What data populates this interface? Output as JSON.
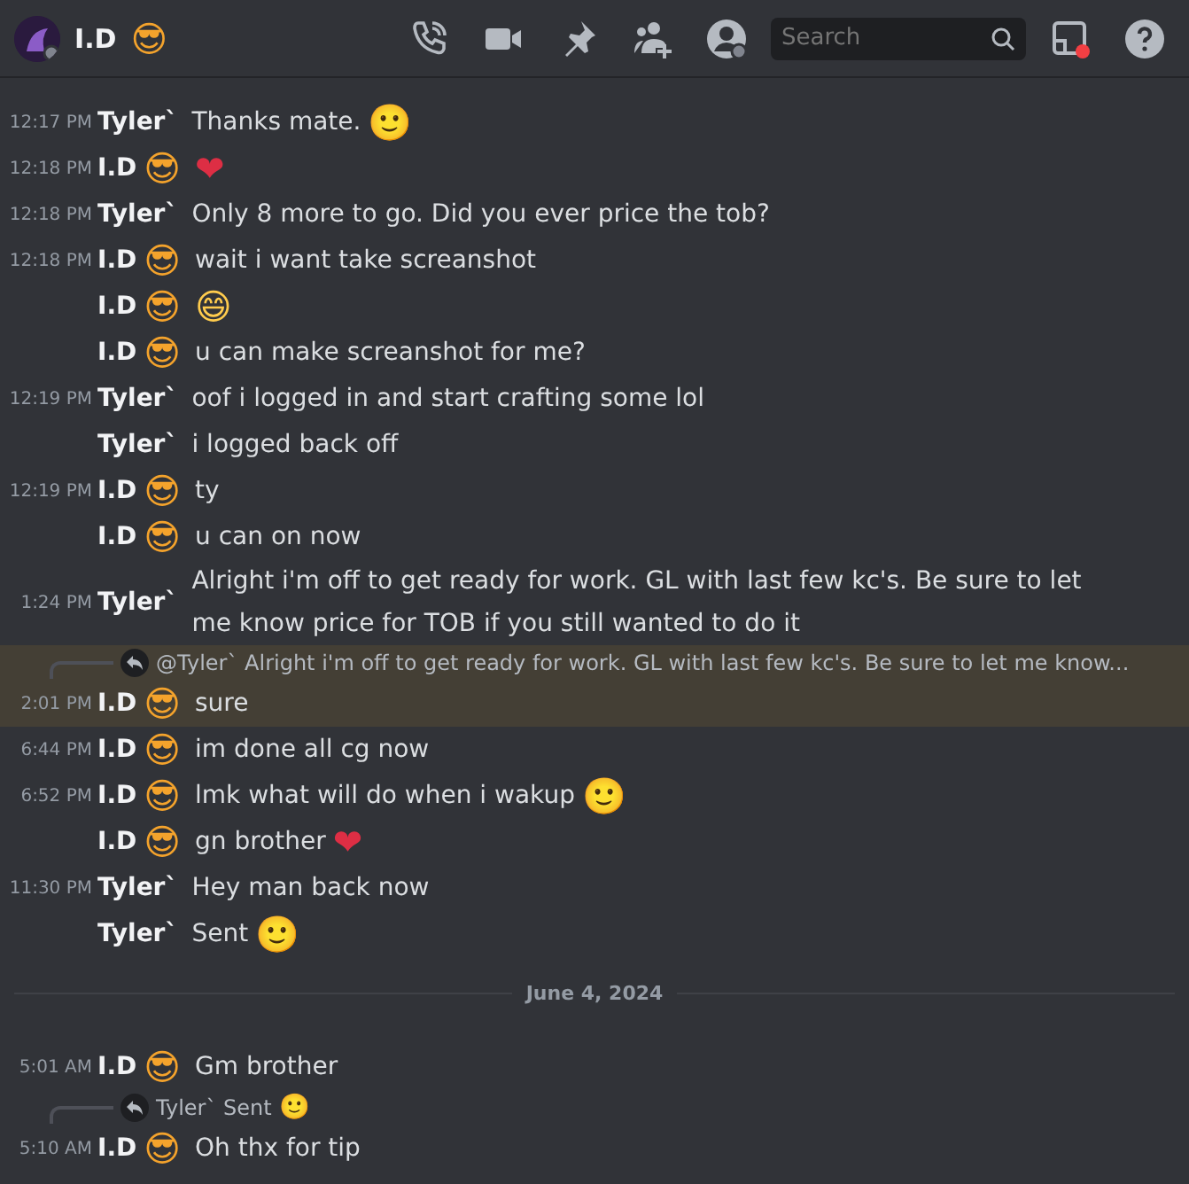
{
  "header": {
    "title": "I.D",
    "title_emoji": {
      "char": "😎",
      "color": "#f4a32c"
    },
    "search": {
      "placeholder": "Search"
    }
  },
  "messages": [
    {
      "time": "12:17 PM",
      "author": "Tyler`",
      "text": "Thanks mate.",
      "emoji": {
        "char": "🙂"
      }
    },
    {
      "time": "12:18 PM",
      "author": "I.D",
      "author_emoji": {
        "char": "😎",
        "color": "#f4a32c"
      },
      "emoji": {
        "char": "❤",
        "color": "#dd2e44"
      }
    },
    {
      "time": "12:18 PM",
      "author": "Tyler`",
      "text": "Only 8 more to go. Did you ever price the tob?"
    },
    {
      "time": "12:18 PM",
      "author": "I.D",
      "author_emoji": {
        "char": "😎",
        "color": "#f4a32c"
      },
      "text": "wait i want take screanshot"
    },
    {
      "author": "I.D",
      "author_emoji": {
        "char": "😎",
        "color": "#f4a32c"
      },
      "emoji": {
        "char": "😄",
        "color": "#ffcc4d"
      }
    },
    {
      "author": "I.D",
      "author_emoji": {
        "char": "😎",
        "color": "#f4a32c"
      },
      "text": "u can make screanshot for me?"
    },
    {
      "time": "12:19 PM",
      "author": "Tyler`",
      "text": "oof i logged in and start crafting some lol"
    },
    {
      "author": "Tyler`",
      "text": "i logged back off"
    },
    {
      "time": "12:19 PM",
      "author": "I.D",
      "author_emoji": {
        "char": "😎",
        "color": "#f4a32c"
      },
      "text": "ty"
    },
    {
      "author": "I.D",
      "author_emoji": {
        "char": "😎",
        "color": "#f4a32c"
      },
      "text": "u can on now"
    },
    {
      "time": "1:24 PM",
      "author": "Tyler`",
      "text": "Alright i'm off to get ready for work. GL with last few kc's. Be sure to let me know price for TOB if you still wanted to do it"
    },
    {
      "time": "2:01 PM",
      "author": "I.D",
      "author_emoji": {
        "char": "😎",
        "color": "#f4a32c"
      },
      "text": "sure",
      "highlighted": true,
      "reply": {
        "text": "@Tyler` Alright i'm off to get ready for work. GL with last few kc's. Be sure to let me know..."
      }
    },
    {
      "time": "6:44 PM",
      "author": "I.D",
      "author_emoji": {
        "char": "😎",
        "color": "#f4a32c"
      },
      "text": "im done all cg now"
    },
    {
      "time": "6:52 PM",
      "author": "I.D",
      "author_emoji": {
        "char": "😎",
        "color": "#f4a32c"
      },
      "text": "lmk what will do when i wakup",
      "emoji": {
        "char": "🙂"
      }
    },
    {
      "author": "I.D",
      "author_emoji": {
        "char": "😎",
        "color": "#f4a32c"
      },
      "text": "gn brother",
      "emoji": {
        "char": "❤",
        "color": "#dd2e44"
      }
    },
    {
      "time": "11:30 PM",
      "author": "Tyler`",
      "text": "Hey man back now"
    },
    {
      "author": "Tyler`",
      "text": "Sent",
      "emoji": {
        "char": "🙂"
      }
    },
    {
      "kind": "divider",
      "text": "June 4, 2024"
    },
    {
      "time": "5:01 AM",
      "author": "I.D",
      "author_emoji": {
        "char": "😎",
        "color": "#f4a32c"
      },
      "text": "Gm brother"
    },
    {
      "time": "5:10 AM",
      "author": "I.D",
      "author_emoji": {
        "char": "😎",
        "color": "#f4a32c"
      },
      "text": "Oh thx for tip",
      "reply": {
        "text": "Tyler` Sent",
        "emoji": {
          "char": "🙂"
        }
      }
    }
  ]
}
